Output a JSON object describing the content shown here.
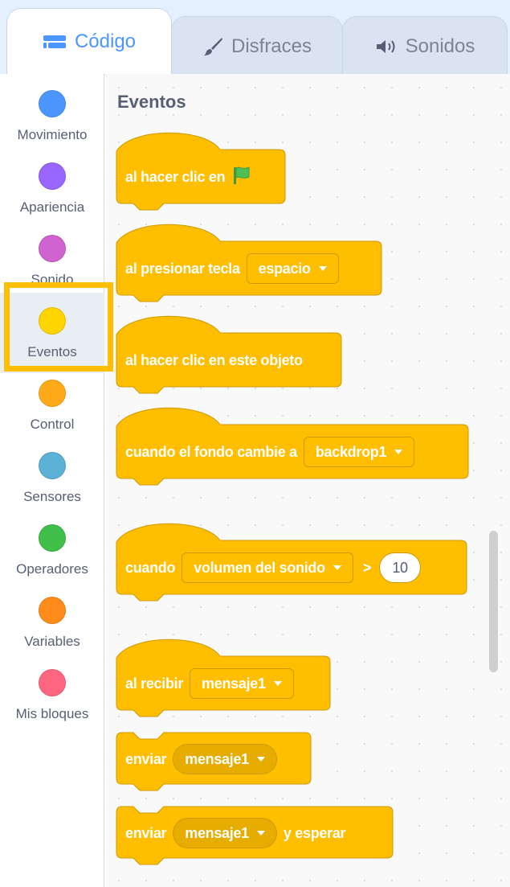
{
  "tabs": [
    {
      "label": "Código",
      "icon": "code-icon",
      "active": true
    },
    {
      "label": "Disfraces",
      "icon": "brush-icon",
      "active": false
    },
    {
      "label": "Sonidos",
      "icon": "speaker-icon",
      "active": false
    }
  ],
  "categories": [
    {
      "label": "Movimiento",
      "color": "#4c97ff"
    },
    {
      "label": "Apariencia",
      "color": "#9966ff"
    },
    {
      "label": "Sonido",
      "color": "#cf63cf"
    },
    {
      "label": "Eventos",
      "color": "#ffd500",
      "selected": true
    },
    {
      "label": "Control",
      "color": "#ffab19"
    },
    {
      "label": "Sensores",
      "color": "#5cb1d6"
    },
    {
      "label": "Operadores",
      "color": "#40bf4a"
    },
    {
      "label": "Variables",
      "color": "#ff8c1a"
    },
    {
      "label": "Mis bloques",
      "color": "#ff6680"
    }
  ],
  "palette": {
    "title": "Eventos",
    "block_color": "#ffbf00",
    "block_border": "#cc9900",
    "blocks": {
      "flag_clicked": {
        "text": "al hacer clic en",
        "icon": "green-flag-icon"
      },
      "key_pressed": {
        "text": "al presionar tecla",
        "dropdown": "espacio"
      },
      "sprite_clicked": {
        "text": "al hacer clic en este objeto"
      },
      "backdrop_switch": {
        "text": "cuando el fondo cambie a",
        "dropdown": "backdrop1"
      },
      "greater_than": {
        "text": "cuando",
        "dropdown": "volumen del sonido",
        "operator": ">",
        "value": "10"
      },
      "receive": {
        "text": "al recibir",
        "dropdown": "mensaje1"
      },
      "broadcast": {
        "text": "enviar",
        "dropdown": "mensaje1"
      },
      "broadcast_wait": {
        "text": "enviar",
        "dropdown": "mensaje1",
        "suffix": "y esperar"
      }
    }
  }
}
